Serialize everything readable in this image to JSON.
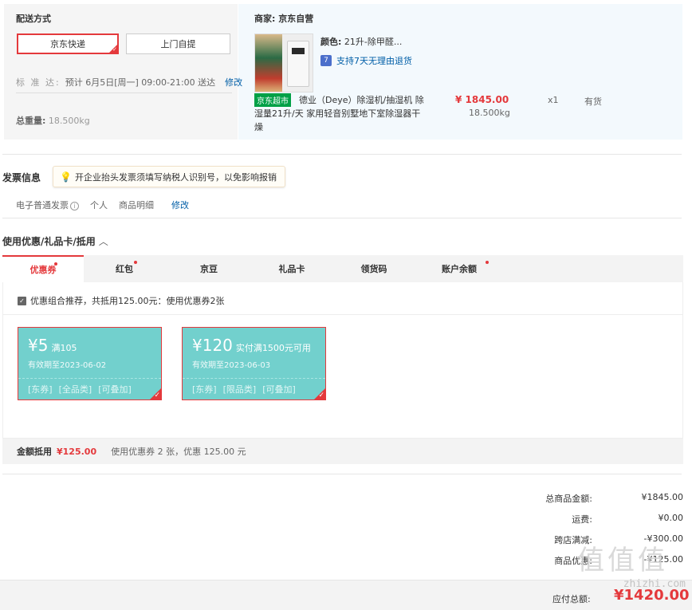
{
  "delivery": {
    "title": "配送方式",
    "options": [
      {
        "label": "京东快递",
        "selected": true
      },
      {
        "label": "上门自提",
        "selected": false
      }
    ],
    "standard_label": "标 准 达:",
    "standard_text": "预计 6月5日[周一] 09:00-21:00 送达",
    "edit_label": "修改",
    "weight_label": "总重量:",
    "weight_value": "18.500kg"
  },
  "shop": {
    "label": "商家:",
    "name": "京东自营",
    "product": {
      "market_badge": "京东超市",
      "title": "德业（Deye）除湿机/抽湿机 除湿量21升/天 家用轻音别墅地下室除湿器干燥",
      "color_label": "颜色:",
      "color_value": "21升-除甲醛...",
      "return_icon": "7",
      "return_text": "支持7天无理由退货",
      "price": "¥ 1845.00",
      "weight": "18.500kg",
      "quantity": "x1",
      "stock": "有货"
    }
  },
  "invoice": {
    "title": "发票信息",
    "tip": "开企业抬头发票须填写纳税人识别号，以免影响报销",
    "type": "电子普通发票",
    "title_type": "个人",
    "content": "商品明细",
    "edit_label": "修改"
  },
  "discounts": {
    "title": "使用优惠/礼品卡/抵用",
    "tabs": [
      {
        "label": "优惠券",
        "active": true,
        "dot": true
      },
      {
        "label": "红包",
        "active": false,
        "dot": true
      },
      {
        "label": "京豆",
        "active": false,
        "dot": false
      },
      {
        "label": "礼品卡",
        "active": false,
        "dot": false
      },
      {
        "label": "领货码",
        "active": false,
        "dot": false
      },
      {
        "label": "账户余额",
        "active": false,
        "dot": true
      }
    ],
    "combo_text": "优惠组合推荐，共抵用125.00元：使用优惠券2张",
    "coupons": [
      {
        "amount": "¥5",
        "condition": "满105",
        "expiry": "有效期至2023-06-02",
        "tags": [
          "[东券]",
          "[全品类]",
          "[可叠加]"
        ],
        "selected": true
      },
      {
        "amount": "¥120",
        "condition": "实付满1500元可用",
        "expiry": "有效期至2023-06-03",
        "tags": [
          "[东券]",
          "[限品类]",
          "[可叠加]"
        ],
        "selected": true
      }
    ],
    "deduct_label": "金额抵用",
    "deduct_value": "¥125.00",
    "deduct_text": "使用优惠券 2 张，优惠 125.00 元"
  },
  "summary": {
    "rows": [
      {
        "label": "总商品金额:",
        "value": "¥1845.00"
      },
      {
        "label": "运费:",
        "value": "¥0.00"
      },
      {
        "label": "跨店满减:",
        "value": "-¥300.00"
      },
      {
        "label": "商品优惠:",
        "value": "-¥125.00"
      }
    ],
    "pay_label": "应付总额:",
    "pay_value": "¥1420.00"
  },
  "watermark": {
    "glyphs": "值值值",
    "url": "zhizhi.com"
  },
  "colors": {
    "accent": "#e4393c",
    "link": "#005ea7",
    "coupon": "#72d0cd",
    "market_badge": "#00a046"
  }
}
